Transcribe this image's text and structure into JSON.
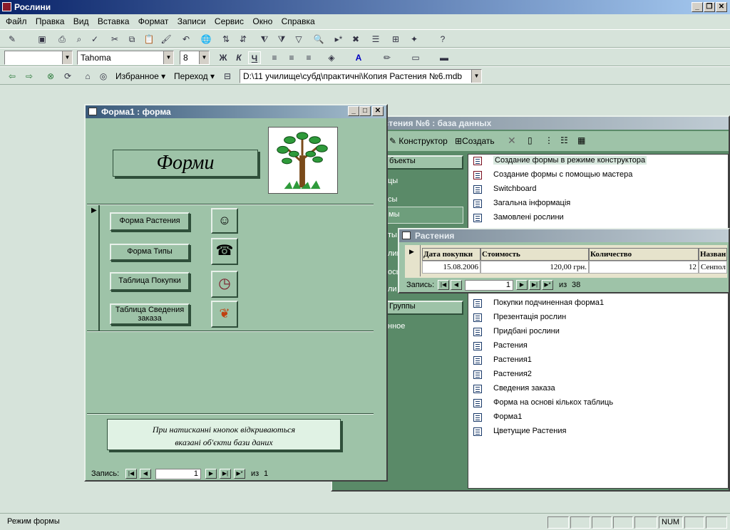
{
  "app": {
    "title": "Рослини"
  },
  "menu": [
    "Файл",
    "Правка",
    "Вид",
    "Вставка",
    "Формат",
    "Записи",
    "Сервис",
    "Окно",
    "Справка"
  ],
  "format_bar": {
    "font": "Tahoma",
    "size": "8",
    "bold": "Ж",
    "italic": "К",
    "underline": "Ч"
  },
  "web_bar": {
    "favorites": "Избранное ▾",
    "goto": "Переход ▾",
    "address": "D:\\11 училище\\субд\\практичні\\Копия Растения №6.mdb"
  },
  "db_window": {
    "title": "астения №6 : база данных",
    "toolbar": {
      "design": "Конструктор",
      "create": "Создать"
    },
    "groups": {
      "objects": "бъекты",
      "groups_label": "Группы",
      "favorites": "нное"
    },
    "object_frags": [
      "цы",
      "сы",
      "мы",
      "ты",
      "лицы",
      "осы",
      "ли"
    ],
    "items": [
      "Создание формы в режиме конструктора",
      "Создание формы с помощью мастера",
      "Switchboard",
      "Загальна інформація",
      "Замовлені рослини",
      "Покупки подчиненная форма1",
      "Презентація рослин",
      "Придбані рослини",
      "Растения",
      "Растения1",
      "Растения2",
      "Сведения заказа",
      "Форма на основі кількох таблиць",
      "Форма1",
      "Цветущие Растения"
    ]
  },
  "table_window": {
    "title": "Растения",
    "columns": [
      "Дата покупки",
      "Стоимость",
      "Количество",
      "Назван"
    ],
    "row": [
      "15.08.2006",
      "120,00 грн.",
      "12",
      "Сенпол"
    ],
    "nav": {
      "label": "Запись:",
      "current": "1",
      "of": "из",
      "total": "38"
    }
  },
  "form_window": {
    "title": "Форма1 : форма",
    "heading": "Форми",
    "buttons": [
      "Форма Растения",
      "Форма Типы",
      "Таблица Покупки",
      "Таблица Сведения заказа"
    ],
    "note_line1": "При натисканні кнопок відкриваються",
    "note_line2": "вказані об'єкти бази даних",
    "nav": {
      "label": "Запись:",
      "current": "1",
      "of": "из",
      "total": "1"
    }
  },
  "status": {
    "mode": "Режим формы",
    "num": "NUM"
  }
}
